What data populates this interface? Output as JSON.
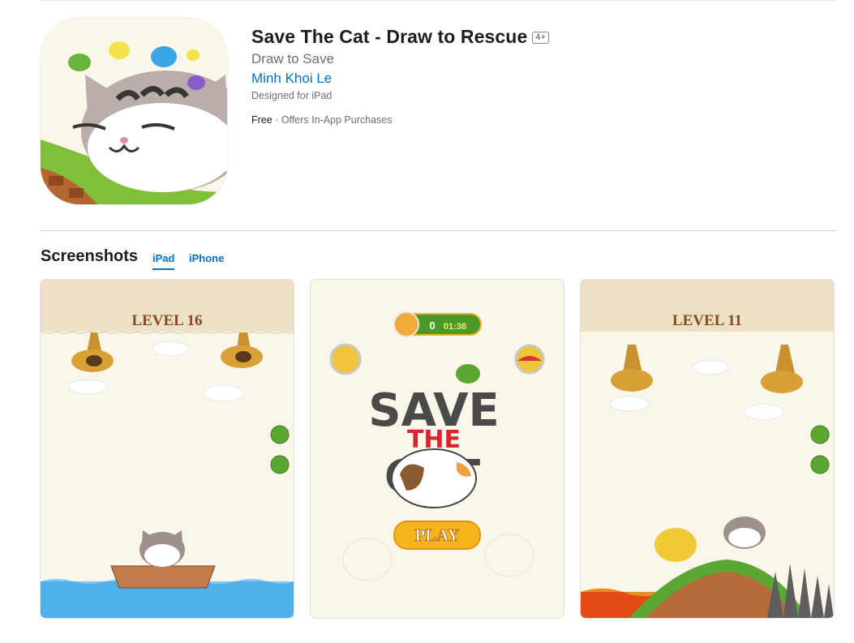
{
  "app": {
    "title": "Save The Cat - Draw to Rescue",
    "age_rating": "4+",
    "subtitle": "Draw to Save",
    "developer": "Minh Khoi Le",
    "designed_for": "Designed for iPad",
    "price": "Free",
    "separator": "·",
    "in_app": "Offers In-App Purchases"
  },
  "screenshots": {
    "heading": "Screenshots",
    "tabs": [
      {
        "label": "iPad",
        "selected": true
      },
      {
        "label": "iPhone",
        "selected": false
      }
    ],
    "items": [
      {
        "level_text": "LEVEL 16"
      },
      {
        "timer_count": "0",
        "timer_time": "01:38",
        "logo_word1": "SAVE",
        "logo_word2": "THE",
        "logo_word3": "CAT",
        "play_label": "PLAY"
      },
      {
        "level_text": "LEVEL 11"
      }
    ]
  },
  "colors": {
    "link": "#0070c9",
    "level_banner": "#ece0c7",
    "level_text": "#8a4a1c",
    "water": "#4fb0ec",
    "grass": "#5aa732",
    "play_button": "#f6b51d"
  }
}
